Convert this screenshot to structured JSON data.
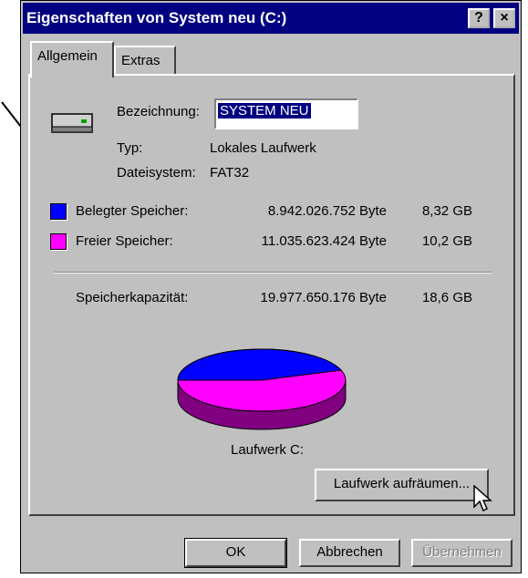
{
  "window": {
    "title": "Eigenschaften von System neu (C:)",
    "help_button": "?",
    "close_button": "×"
  },
  "tabs": [
    {
      "label": "Allgemein",
      "active": true
    },
    {
      "label": "Extras",
      "active": false
    }
  ],
  "general": {
    "name_label": "Bezeichnung:",
    "name_value": "SYSTEM NEU",
    "type_label": "Typ:",
    "type_value": "Lokales Laufwerk",
    "fs_label": "Dateisystem:",
    "fs_value": "FAT32"
  },
  "usage": {
    "used": {
      "label": "Belegter Speicher:",
      "bytes": "8.942.026.752 Byte",
      "gb": "8,32 GB",
      "color": "#0000ff"
    },
    "free": {
      "label": "Freier Speicher:",
      "bytes": "11.035.623.424 Byte",
      "gb": "10,2 GB",
      "color": "#ff00ff"
    },
    "capacity": {
      "label": "Speicherkapazität:",
      "bytes": "19.977.650.176 Byte",
      "gb": "18,6 GB"
    }
  },
  "pie": {
    "used_fraction": 0.4476,
    "caption": "Laufwerk C:"
  },
  "buttons": {
    "cleanup": "Laufwerk aufräumen...",
    "ok": "OK",
    "cancel": "Abbrechen",
    "apply": "Übernehmen"
  },
  "icons": {
    "drive": "hard-drive-icon",
    "cursor": "mouse-pointer-icon",
    "arrow": "annotation-arrow"
  }
}
